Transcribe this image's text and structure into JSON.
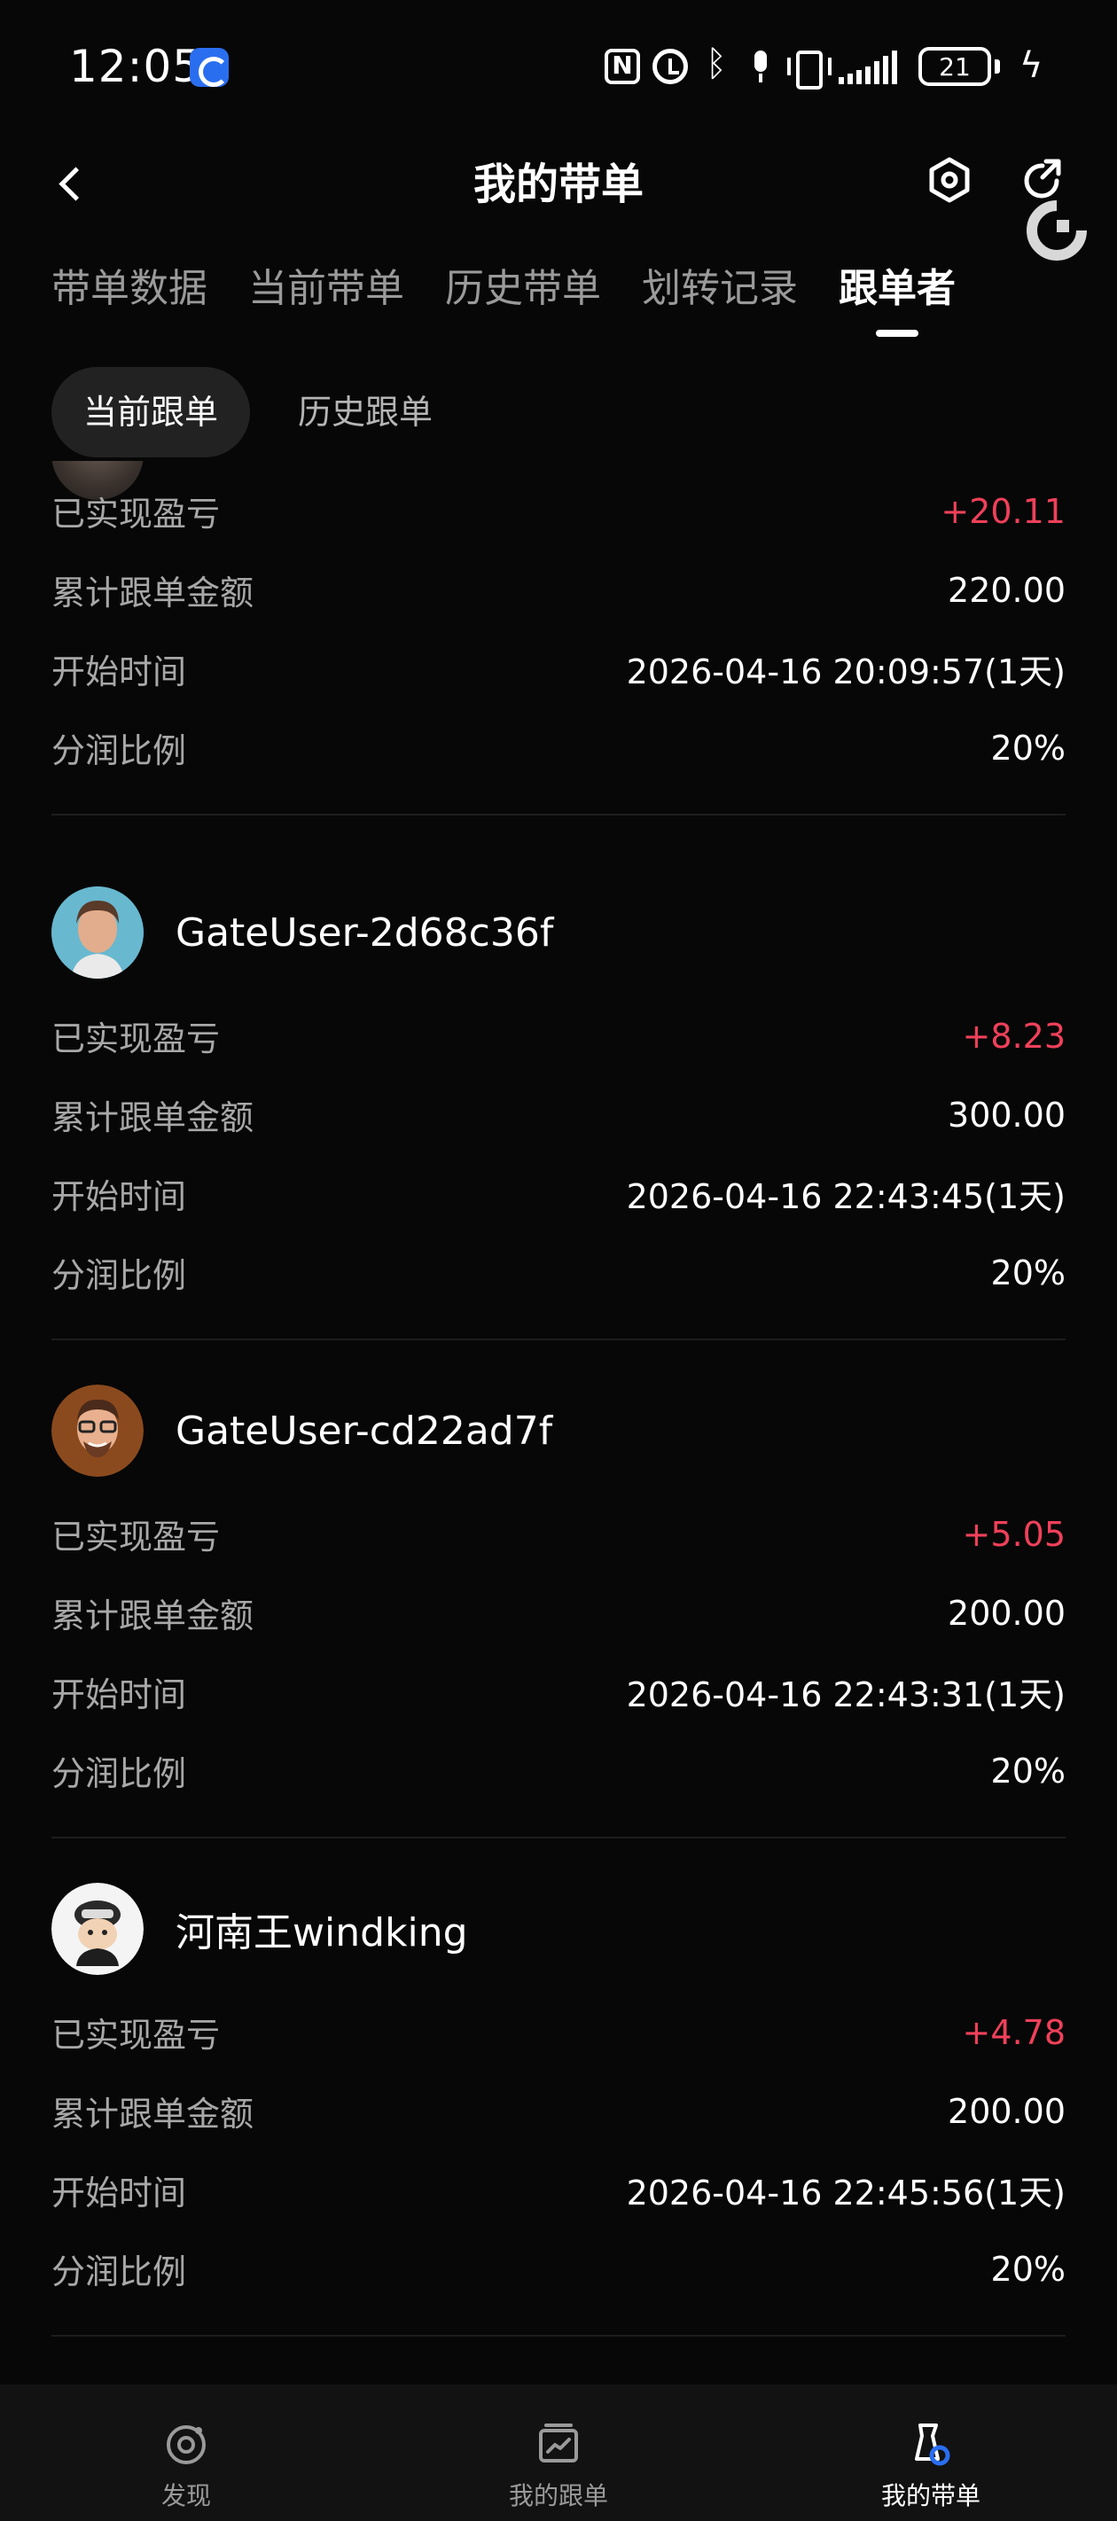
{
  "status_bar": {
    "time": "12:05",
    "battery": "21"
  },
  "header": {
    "title": "我的带单"
  },
  "tabs": [
    {
      "label": "带单数据"
    },
    {
      "label": "当前带单"
    },
    {
      "label": "历史带单"
    },
    {
      "label": "划转记录"
    },
    {
      "label": "跟单者"
    }
  ],
  "subtabs": [
    {
      "label": "当前跟单"
    },
    {
      "label": "历史跟单"
    }
  ],
  "followers": [
    {
      "rows": [
        {
          "label": "已实现盈亏",
          "value": "+20.11"
        },
        {
          "label": "累计跟单金额",
          "value": "220.00"
        },
        {
          "label": "开始时间",
          "value": "2026-04-16 20:09:57(1天)"
        },
        {
          "label": "分润比例",
          "value": "20%"
        }
      ]
    },
    {
      "name": "GateUser-2d68c36f",
      "rows": [
        {
          "label": "已实现盈亏",
          "value": "+8.23"
        },
        {
          "label": "累计跟单金额",
          "value": "300.00"
        },
        {
          "label": "开始时间",
          "value": "2026-04-16 22:43:45(1天)"
        },
        {
          "label": "分润比例",
          "value": "20%"
        }
      ]
    },
    {
      "name": "GateUser-cd22ad7f",
      "rows": [
        {
          "label": "已实现盈亏",
          "value": "+5.05"
        },
        {
          "label": "累计跟单金额",
          "value": "200.00"
        },
        {
          "label": "开始时间",
          "value": "2026-04-16 22:43:31(1天)"
        },
        {
          "label": "分润比例",
          "value": "20%"
        }
      ]
    },
    {
      "name": "河南王windking",
      "rows": [
        {
          "label": "已实现盈亏",
          "value": "+4.78"
        },
        {
          "label": "累计跟单金额",
          "value": "200.00"
        },
        {
          "label": "开始时间",
          "value": "2026-04-16 22:45:56(1天)"
        },
        {
          "label": "分润比例",
          "value": "20%"
        }
      ]
    }
  ],
  "bottom_nav": [
    {
      "label": "发现",
      "icon": "discover-icon"
    },
    {
      "label": "我的跟单",
      "icon": "my-copy-icon"
    },
    {
      "label": "我的带单",
      "icon": "my-lead-icon"
    }
  ],
  "colors": {
    "profit": "#f0405a",
    "background": "#070707",
    "accent": "#2a6ef0"
  }
}
